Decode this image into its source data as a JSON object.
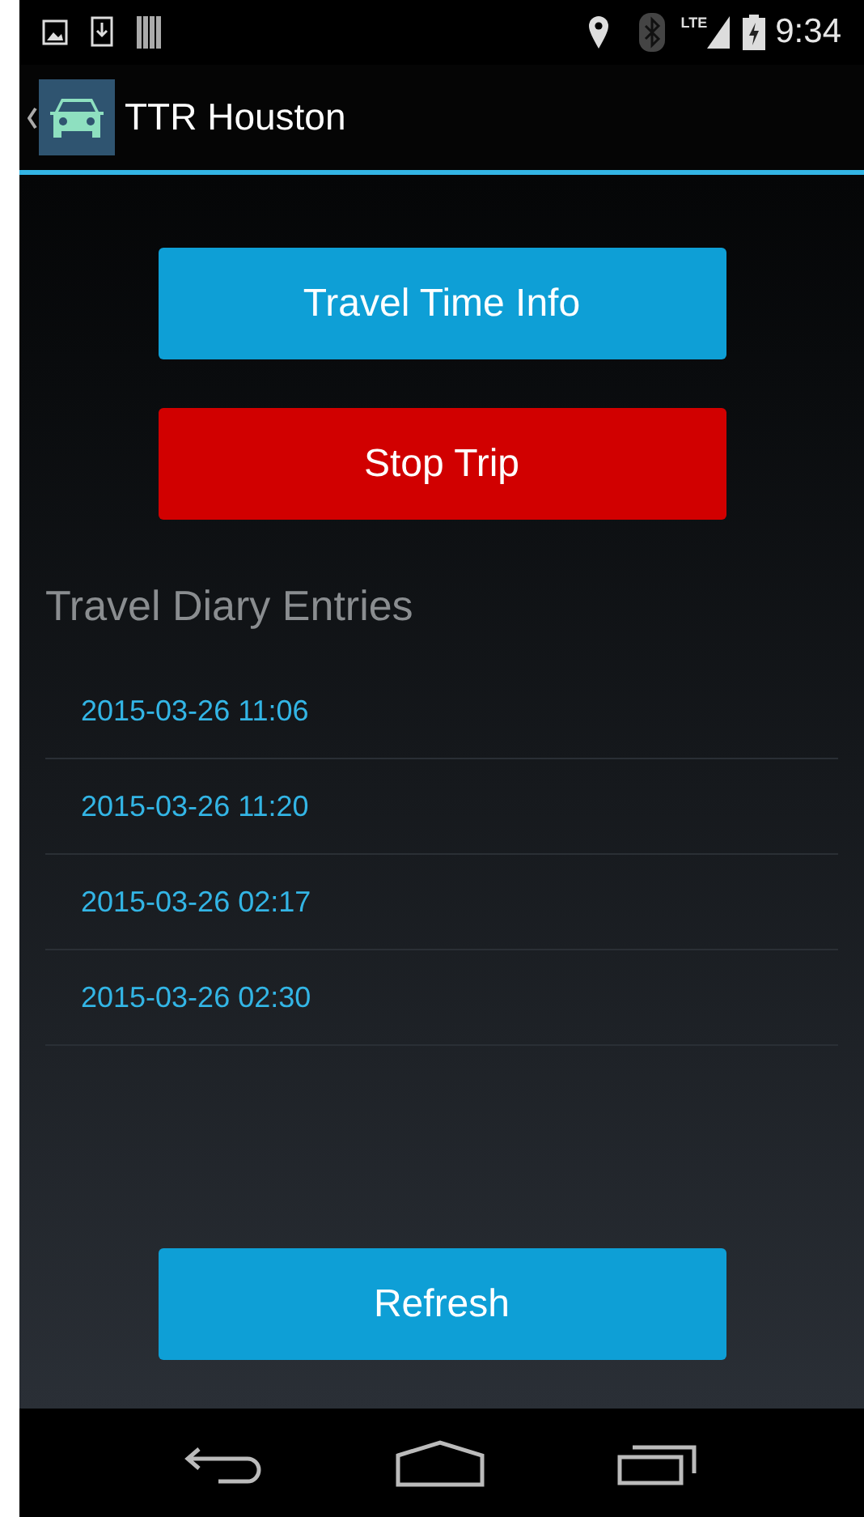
{
  "status_bar": {
    "time": "9:34",
    "network": "LTE"
  },
  "action_bar": {
    "title": "TTR Houston"
  },
  "buttons": [
    {
      "label": "Travel Time Info",
      "kind": "primary"
    },
    {
      "label": "Stop Trip",
      "kind": "danger"
    }
  ],
  "diary": {
    "heading": "Travel Diary Entries",
    "entries": [
      "2015-03-26 11:06",
      "2015-03-26 11:20",
      "2015-03-26 02:17",
      "2015-03-26 02:30"
    ]
  },
  "refresh_button": {
    "label": "Refresh",
    "kind": "primary"
  }
}
